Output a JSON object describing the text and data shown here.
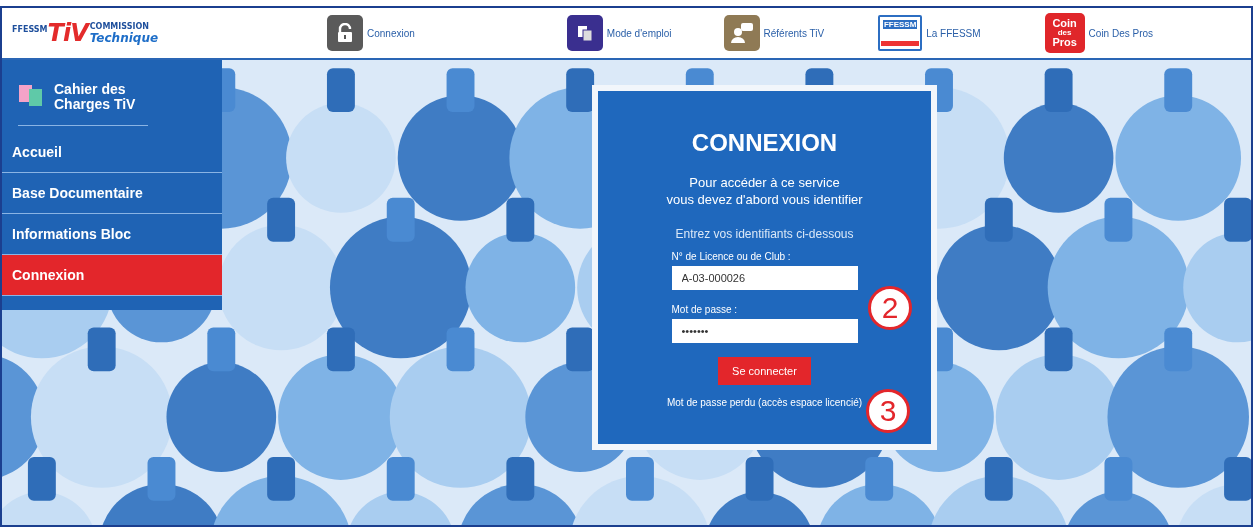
{
  "logo": {
    "badge": "FFESSM",
    "mark": "TiV",
    "top": "COMMISSION",
    "bottom": "Technique"
  },
  "nav": [
    {
      "kind": "lock",
      "label": "Connexion"
    },
    {
      "kind": "document",
      "label": "Mode d'emploi"
    },
    {
      "kind": "person",
      "label": "Référents TiV"
    },
    {
      "kind": "flag",
      "label": "La FFESSM",
      "icon_text": "FFESSM"
    },
    {
      "kind": "coin",
      "label": "Coin Des Pros",
      "icon_text": [
        "Coin",
        "des",
        "Pros"
      ]
    }
  ],
  "sidebar": {
    "title": "Cahier des Charges TiV",
    "items": [
      {
        "label": "Accueil",
        "selected": false
      },
      {
        "label": "Base Documentaire",
        "selected": false
      },
      {
        "label": "Informations Bloc",
        "selected": false
      },
      {
        "label": "Connexion",
        "selected": true
      }
    ]
  },
  "login": {
    "title": "CONNEXION",
    "intro": [
      "Pour accéder à ce service",
      "vous devez d'abord vous identifier"
    ],
    "hint": "Entrez vos identifiants ci-dessous",
    "fields": [
      {
        "label": "N° de Licence ou de Club :",
        "value": "A-03-000026"
      },
      {
        "label": "Mot de passe :",
        "value": "•••••••"
      }
    ],
    "button": "Se connecter",
    "link": "Mot de passe perdu (accès espace licencié)"
  },
  "annotations": [
    "2",
    "3"
  ]
}
